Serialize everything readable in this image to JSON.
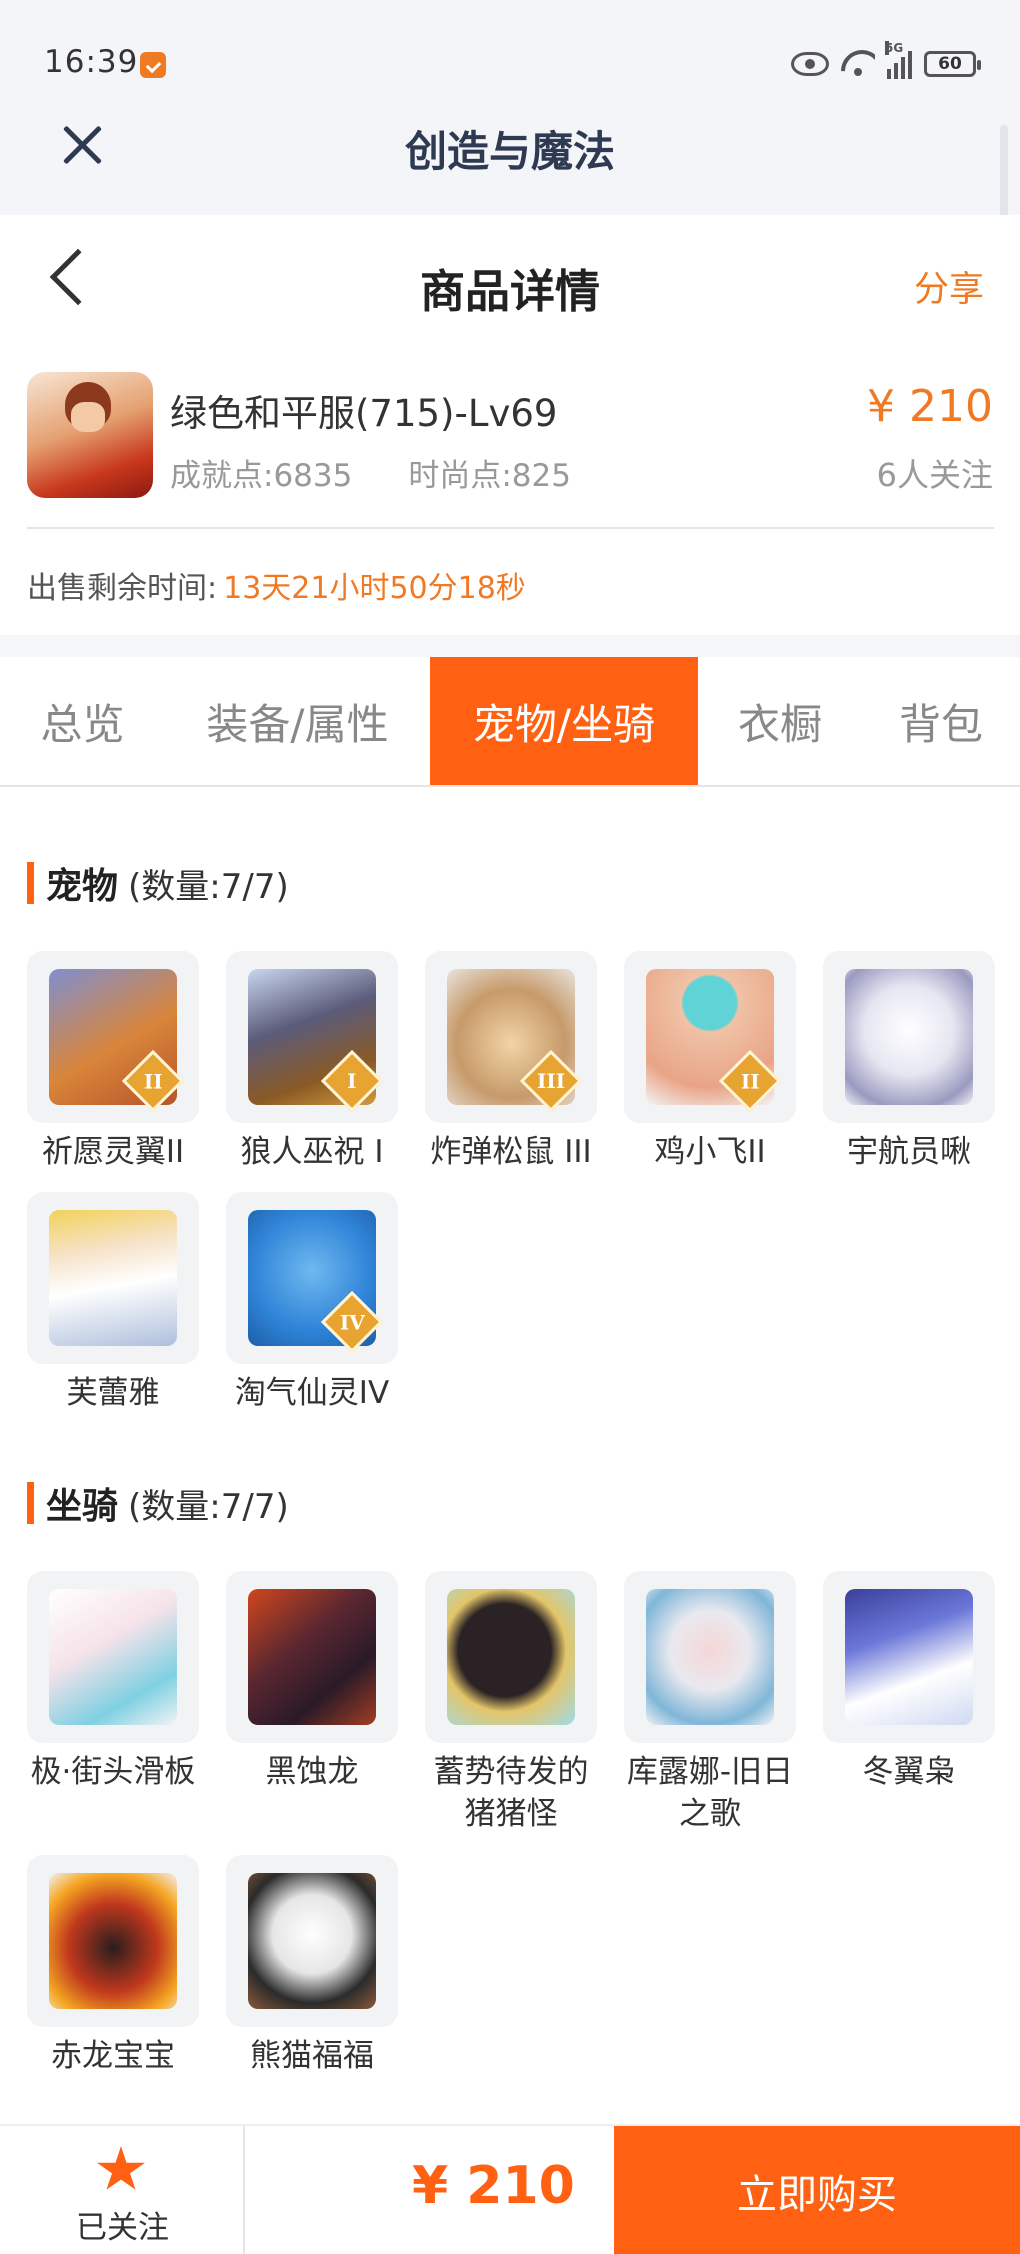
{
  "status_bar": {
    "time": "16:39",
    "network": "5G",
    "battery": "60"
  },
  "webview": {
    "title": "创造与魔法"
  },
  "header": {
    "title": "商品详情",
    "share": "分享"
  },
  "product": {
    "name": "绿色和平服(715)-Lv69",
    "achievement": "成就点:6835",
    "fashion": "时尚点:825",
    "price": "¥ 210",
    "followers": "6人关注",
    "remaining_label": "出售剩余时间:",
    "remaining_value": "13天21小时50分18秒"
  },
  "tabs": [
    {
      "label": "总览"
    },
    {
      "label": "装备/属性"
    },
    {
      "label": "宠物/坐骑"
    },
    {
      "label": "衣橱"
    },
    {
      "label": "背包"
    }
  ],
  "active_tab": "宠物/坐骑",
  "pets": {
    "title": "宠物",
    "count": "(数量:7/7)",
    "items": [
      {
        "label": "祈愿灵翼II",
        "badge": "II"
      },
      {
        "label": "狼人巫祝 I",
        "badge": "I"
      },
      {
        "label": "炸弹松鼠 III",
        "badge": "III"
      },
      {
        "label": "鸡小飞II",
        "badge": "II"
      },
      {
        "label": "宇航员啾",
        "badge": ""
      },
      {
        "label": "芙蕾雅",
        "badge": ""
      },
      {
        "label": "淘气仙灵IV",
        "badge": "IV"
      }
    ]
  },
  "mounts": {
    "title": "坐骑",
    "count": "(数量:7/7)",
    "items": [
      {
        "label": "极·街头滑板"
      },
      {
        "label": "黑蚀龙"
      },
      {
        "label": "蓄势待发的猪猪怪"
      },
      {
        "label": "库露娜-旧日之歌"
      },
      {
        "label": "冬翼枭"
      },
      {
        "label": "赤龙宝宝"
      },
      {
        "label": "熊猫福福"
      }
    ]
  },
  "bottom_bar": {
    "follow_label": "已关注",
    "price": "¥ 210",
    "buy_label": "立即购买"
  },
  "colors": {
    "accent": "#ff6012",
    "price": "#f07a23"
  }
}
